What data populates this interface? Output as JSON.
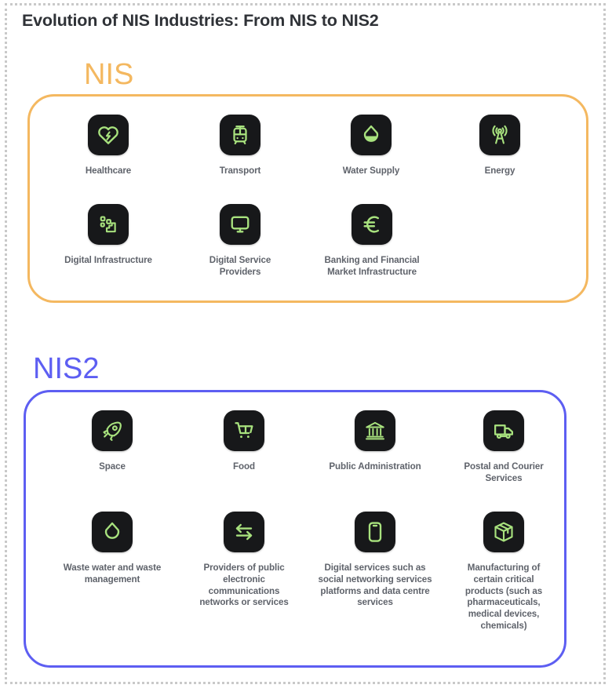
{
  "page": {
    "title": "Evolution of NIS Industries: From NIS to NIS2",
    "border_color": "#c9c9c9",
    "background": "#ffffff"
  },
  "theme": {
    "nis_color": "#f4b860",
    "nis2_color": "#5d5ef2",
    "tile_bg": "#17181a",
    "icon_color": "#a8e27e",
    "caption_color": "#5f636b",
    "title_color": "#2f3237"
  },
  "groups": [
    {
      "label": "NIS",
      "color": "#f4b860",
      "rows": [
        [
          {
            "label": "Healthcare",
            "icon": "heart-pulse-icon"
          },
          {
            "label": "Transport",
            "icon": "tram-icon"
          },
          {
            "label": "Water Supply",
            "icon": "water-drop-filled-icon"
          },
          {
            "label": "Energy",
            "icon": "antenna-signal-icon"
          }
        ],
        [
          {
            "label": "Digital Infrastructure",
            "icon": "network-nodes-icon"
          },
          {
            "label": "Digital Service Providers",
            "icon": "monitor-icon"
          },
          {
            "label": "Banking and Financial Market Infrastructure",
            "icon": "euro-icon"
          }
        ]
      ]
    },
    {
      "label": "NIS2",
      "color": "#5d5ef2",
      "rows": [
        [
          {
            "label": "Space",
            "icon": "rocket-icon"
          },
          {
            "label": "Food",
            "icon": "shopping-cart-icon"
          },
          {
            "label": "Public Administration",
            "icon": "bank-building-icon"
          },
          {
            "label": "Postal and Courier Services",
            "icon": "delivery-truck-icon"
          }
        ],
        [
          {
            "label": "Waste water and waste management",
            "icon": "water-drop-outline-icon"
          },
          {
            "label": "Providers of public electronic communications networks or services",
            "icon": "exchange-arrows-icon"
          },
          {
            "label": "Digital services such as social networking services platforms and data centre services",
            "icon": "smartphone-icon"
          },
          {
            "label": "Manufacturing of certain critical products (such as pharmaceuticals, medical devices, chemicals)",
            "icon": "package-box-icon"
          }
        ]
      ]
    }
  ]
}
